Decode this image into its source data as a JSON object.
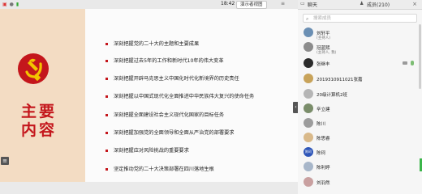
{
  "topbar": {
    "time": "18:42",
    "present_button": "演示者视图"
  },
  "slide": {
    "title_line1": "主要",
    "title_line2": "内容",
    "menu_icon": "≡",
    "collapse_icon": "‹",
    "bullets": [
      "深刻把握党的二十大的主题和主要成果",
      "深刻把握过去5年的工作和新时代10年的伟大变革",
      "深刻把握开辟马克思主义中国化时代化新境界的历史责任",
      "深刻把握以中国式现代化全面推进中华民族伟大复兴的使命任务",
      "深刻把握全面建设社会主义现代化国家的目标任务",
      "深刻把握加强党的全面领导和全面从严治党的部署要求",
      "深刻把握应对风险挑战的重要要求",
      "坚定推动党的二十大决策部署在四川落地生根"
    ],
    "colors": {
      "red": "#c4161c",
      "gold": "#f2c400",
      "left_bg": "#f3dcc3"
    }
  },
  "panel": {
    "tab_chat": "聊天",
    "tab_members": "成员(210)",
    "search_placeholder": "搜索成员",
    "members": [
      {
        "name": "刘轩平",
        "sub": "(主持人)",
        "avatar_color": "#6b8fb3"
      },
      {
        "name": "冠蓝熙",
        "sub": "(主持人, 我)",
        "avatar_color": "#8c8c8c"
      },
      {
        "name": "张继丰",
        "sub": "",
        "avatar_color": "#2b2b2b"
      },
      {
        "name": "2019310911021张嘉",
        "sub": "",
        "avatar_color": "#c8a35a"
      },
      {
        "name": "20级计算机2班",
        "sub": "",
        "avatar_color": "#b5b5b5"
      },
      {
        "name": "辛立建",
        "sub": "",
        "avatar_color": "#7a8d6a"
      },
      {
        "name": "陈川",
        "sub": "",
        "avatar_color": "#9c9c9c"
      },
      {
        "name": "陈思睿",
        "sub": "",
        "avatar_color": "#d9b98a"
      },
      {
        "name": "陈珂",
        "sub": "",
        "avatar_color": "#2f56b8",
        "badge": "陈珂"
      },
      {
        "name": "陈利婷",
        "sub": "",
        "avatar_color": "#a7b6c9"
      },
      {
        "name": "刘羽然",
        "sub": "",
        "avatar_color": "#c9a0a0"
      }
    ]
  }
}
